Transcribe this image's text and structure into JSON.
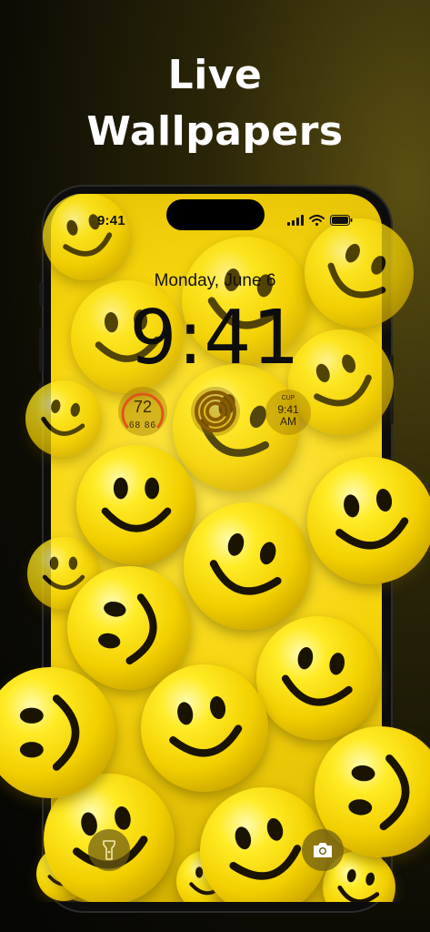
{
  "headline": {
    "line1": "Live",
    "line2": "Wallpapers"
  },
  "status_bar": {
    "time": "9:41",
    "icons": [
      "signal-bars-icon",
      "wifi-icon",
      "battery-icon"
    ]
  },
  "lock_screen": {
    "date": "Monday, June 6",
    "time": "9:41",
    "widgets": {
      "temperature": {
        "current": "72",
        "range": "68 86"
      },
      "activity_rings": {
        "icon": "activity-rings-icon"
      },
      "world_clock": {
        "city": "CUP",
        "time": "9:41",
        "ampm": "AM"
      }
    }
  },
  "quick_actions": {
    "left": "flashlight-icon",
    "right": "camera-icon"
  },
  "colors": {
    "accent_yellow": "#f6d40c",
    "background_dark": "#0d0c04",
    "text_white": "#ffffff"
  }
}
